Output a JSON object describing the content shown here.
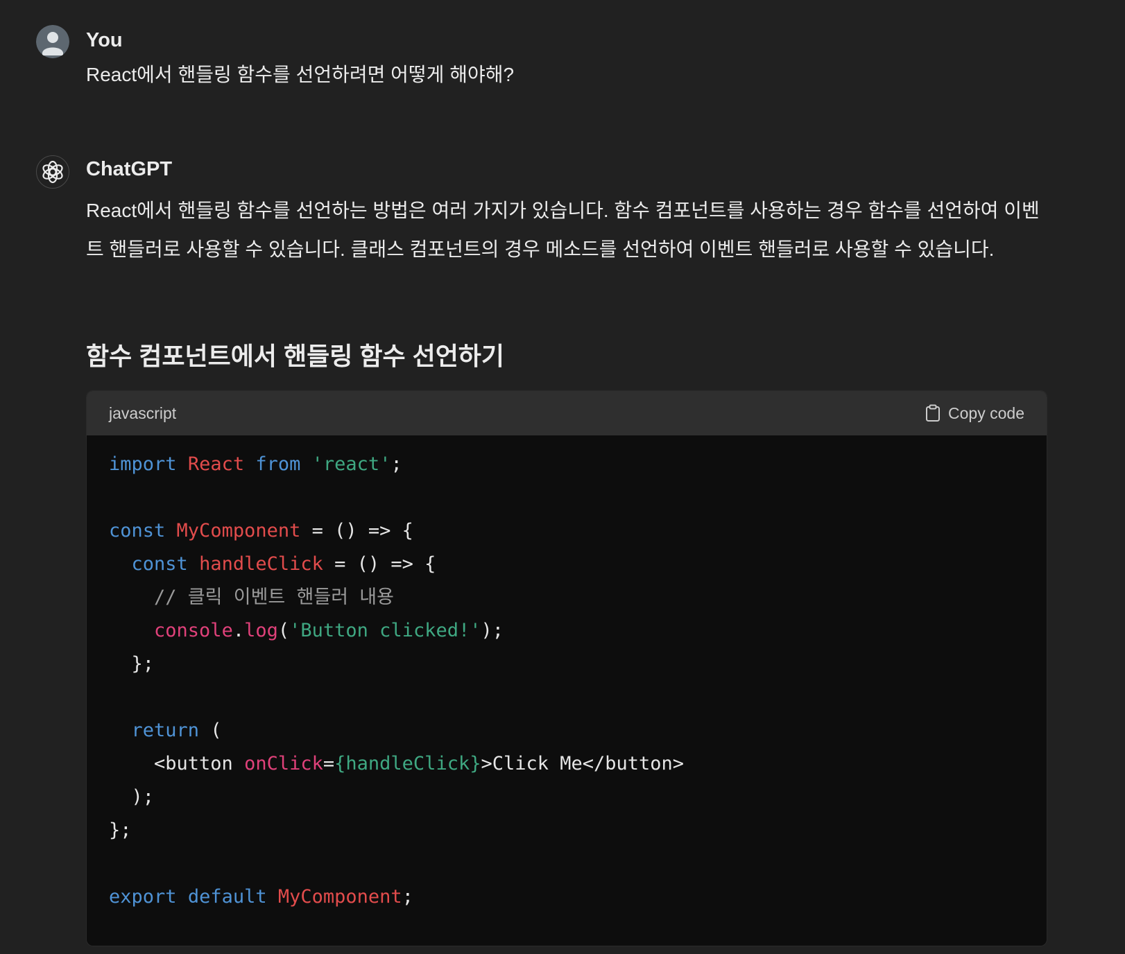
{
  "user_message": {
    "author": "You",
    "text": "React에서 핸들링 함수를 선언하려면 어떻게 해야해?"
  },
  "assistant_message": {
    "author": "ChatGPT",
    "paragraph": "React에서 핸들링 함수를 선언하는 방법은 여러 가지가 있습니다. 함수 컴포넌트를 사용하는 경우 함수를 선언하여 이벤트 핸들러로 사용할 수 있습니다. 클래스 컴포넌트의 경우 메소드를 선언하여 이벤트 핸들러로 사용할 수 있습니다.",
    "heading": "함수 컴포넌트에서 핸들링 함수 선언하기",
    "code_block": {
      "language": "javascript",
      "copy_label": "Copy code",
      "copy_icon": "clipboard-icon",
      "lines": [
        [
          {
            "t": "import",
            "c": "keyword"
          },
          {
            "t": " ",
            "c": "plain"
          },
          {
            "t": "React",
            "c": "ident"
          },
          {
            "t": " ",
            "c": "plain"
          },
          {
            "t": "from",
            "c": "keyword"
          },
          {
            "t": " ",
            "c": "plain"
          },
          {
            "t": "'react'",
            "c": "string"
          },
          {
            "t": ";",
            "c": "plain"
          }
        ],
        [],
        [
          {
            "t": "const",
            "c": "keyword"
          },
          {
            "t": " ",
            "c": "plain"
          },
          {
            "t": "MyComponent",
            "c": "ident"
          },
          {
            "t": " = () => {",
            "c": "plain"
          }
        ],
        [
          {
            "t": "  ",
            "c": "plain"
          },
          {
            "t": "const",
            "c": "keyword"
          },
          {
            "t": " ",
            "c": "plain"
          },
          {
            "t": "handleClick",
            "c": "ident"
          },
          {
            "t": " = () => {",
            "c": "plain"
          }
        ],
        [
          {
            "t": "    ",
            "c": "plain"
          },
          {
            "t": "// 클릭 이벤트 핸들러 내용",
            "c": "comment"
          }
        ],
        [
          {
            "t": "    ",
            "c": "plain"
          },
          {
            "t": "console",
            "c": "console"
          },
          {
            "t": ".",
            "c": "plain"
          },
          {
            "t": "log",
            "c": "console"
          },
          {
            "t": "(",
            "c": "plain"
          },
          {
            "t": "'Button clicked!'",
            "c": "string"
          },
          {
            "t": ");",
            "c": "plain"
          }
        ],
        [
          {
            "t": "  };",
            "c": "plain"
          }
        ],
        [],
        [
          {
            "t": "  ",
            "c": "plain"
          },
          {
            "t": "return",
            "c": "keyword"
          },
          {
            "t": " (",
            "c": "plain"
          }
        ],
        [
          {
            "t": "    <button ",
            "c": "plain"
          },
          {
            "t": "onClick",
            "c": "attr"
          },
          {
            "t": "=",
            "c": "plain"
          },
          {
            "t": "{handleClick}",
            "c": "string"
          },
          {
            "t": ">Click Me</button>",
            "c": "plain"
          }
        ],
        [
          {
            "t": "  );",
            "c": "plain"
          }
        ],
        [
          {
            "t": "};",
            "c": "plain"
          }
        ],
        [],
        [
          {
            "t": "export",
            "c": "keyword"
          },
          {
            "t": " ",
            "c": "plain"
          },
          {
            "t": "default",
            "c": "keyword"
          },
          {
            "t": " ",
            "c": "plain"
          },
          {
            "t": "MyComponent",
            "c": "ident"
          },
          {
            "t": ";",
            "c": "plain"
          }
        ]
      ]
    }
  },
  "colors": {
    "background": "#212121",
    "code_background": "#0d0d0d",
    "code_header": "#2f2f2f",
    "keyword": "#4f93d6",
    "identifier": "#e24c4c",
    "string": "#3fa882",
    "comment": "#9a9a9a"
  }
}
